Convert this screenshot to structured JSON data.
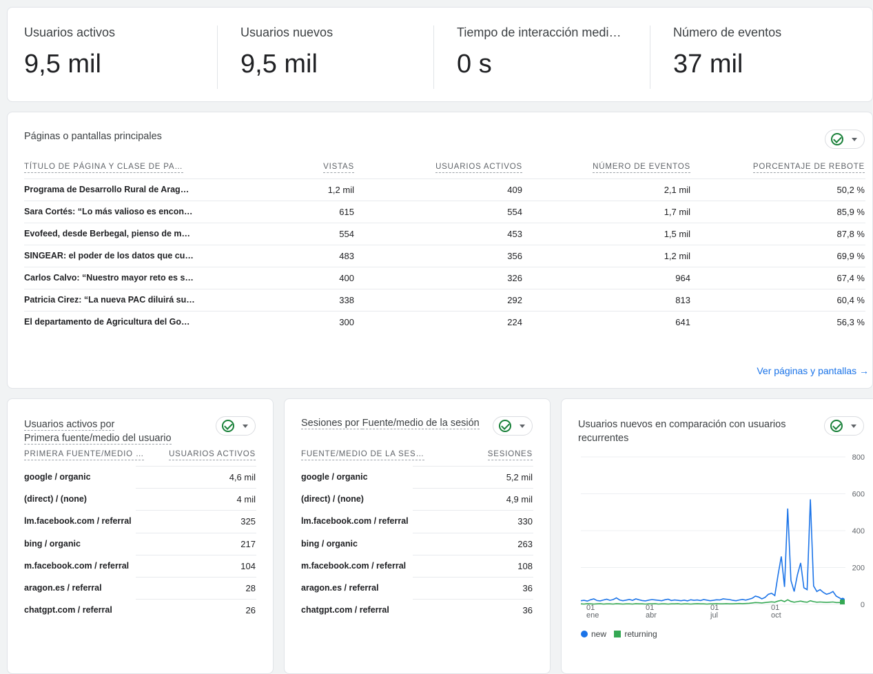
{
  "kpis": [
    {
      "label": "Usuarios activos",
      "value": "9,5 mil"
    },
    {
      "label": "Usuarios nuevos",
      "value": "9,5 mil"
    },
    {
      "label": "Tiempo de interacción medi…",
      "value": "0 s"
    },
    {
      "label": "Número de eventos",
      "value": "37 mil"
    }
  ],
  "pages": {
    "title": "Páginas o pantallas principales",
    "headers": [
      "TÍTULO DE PÁGINA Y CLASE DE PA…",
      "VISTAS",
      "USUARIOS ACTIVOS",
      "NÚMERO DE EVENTOS",
      "PORCENTAJE DE REBOTE"
    ],
    "rows": [
      [
        "Programa de Desarrollo Rural de Arag…",
        "1,2 mil",
        "409",
        "2,1 mil",
        "50,2 %"
      ],
      [
        "Sara Cortés: “Lo más valioso es encon…",
        "615",
        "554",
        "1,7 mil",
        "85,9 %"
      ],
      [
        "Evofeed, desde Berbegal, pienso de m…",
        "554",
        "453",
        "1,5 mil",
        "87,8 %"
      ],
      [
        "SINGEAR: el poder de los datos que cu…",
        "483",
        "356",
        "1,2 mil",
        "69,9 %"
      ],
      [
        "Carlos Calvo: “Nuestro mayor reto es s…",
        "400",
        "326",
        "964",
        "67,4 %"
      ],
      [
        "Patricia Cirez: “La nueva PAC diluirá su…",
        "338",
        "292",
        "813",
        "60,4 %"
      ],
      [
        "El departamento de Agricultura del Go…",
        "300",
        "224",
        "641",
        "56,3 %"
      ]
    ],
    "link": "Ver páginas y pantallas"
  },
  "sources": {
    "title_line1": "Usuarios activos por",
    "title_line2": "Primera fuente/medio del usuario",
    "headers": [
      "PRIMERA FUENTE/MEDIO …",
      "USUARIOS ACTIVOS"
    ],
    "rows": [
      [
        "google / organic",
        "4,6 mil"
      ],
      [
        "(direct) / (none)",
        "4 mil"
      ],
      [
        "lm.facebook.com / referral",
        "325"
      ],
      [
        "bing / organic",
        "217"
      ],
      [
        "m.facebook.com / referral",
        "104"
      ],
      [
        "aragon.es / referral",
        "28"
      ],
      [
        "chatgpt.com / referral",
        "26"
      ]
    ]
  },
  "sessions": {
    "title_prefix": "Sesiones por ",
    "title_dim": "Fuente/medio de la sesión",
    "headers": [
      "FUENTE/MEDIO DE LA SES…",
      "SESIONES"
    ],
    "rows": [
      [
        "google / organic",
        "5,2 mil"
      ],
      [
        "(direct) / (none)",
        "4,9 mil"
      ],
      [
        "lm.facebook.com / referral",
        "330"
      ],
      [
        "bing / organic",
        "263"
      ],
      [
        "m.facebook.com / referral",
        "108"
      ],
      [
        "aragon.es / referral",
        "36"
      ],
      [
        "chatgpt.com / referral",
        "36"
      ]
    ]
  },
  "newret": {
    "title_line1": "Usuarios nuevos en comparación con usuarios",
    "title_line2": "recurrentes",
    "legend_new": "new",
    "legend_ret": "returning"
  },
  "colors": {
    "new": "#1a73e8",
    "returning": "#34a853",
    "accent": "#1a73e8"
  },
  "chart_data": {
    "type": "line",
    "x_ticks": [
      [
        "01",
        "ene"
      ],
      [
        "01",
        "abr"
      ],
      [
        "01",
        "jul"
      ],
      [
        "01",
        "oct"
      ]
    ],
    "y_ticks": [
      "0",
      "200",
      "400",
      "600",
      "800"
    ],
    "ylim": [
      0,
      800
    ],
    "series": [
      {
        "name": "new",
        "values": [
          20,
          22,
          18,
          25,
          30,
          21,
          19,
          24,
          28,
          22,
          26,
          35,
          24,
          20,
          23,
          27,
          22,
          30,
          25,
          21,
          19,
          23,
          26,
          24,
          22,
          20,
          25,
          28,
          21,
          24,
          22,
          20,
          23,
          19,
          25,
          22,
          24,
          21,
          26,
          23,
          20,
          22,
          25,
          24,
          30,
          28,
          26,
          22,
          20,
          24,
          27,
          23,
          28,
          33,
          45,
          40,
          30,
          38,
          55,
          60,
          48,
          160,
          260,
          95,
          520,
          130,
          70,
          160,
          225,
          90,
          80,
          570,
          100,
          70,
          80,
          65,
          55,
          60,
          70,
          45,
          35,
          25
        ]
      },
      {
        "name": "returning",
        "values": [
          3,
          2,
          4,
          3,
          2,
          3,
          4,
          2,
          3,
          3,
          2,
          4,
          3,
          2,
          3,
          3,
          2,
          4,
          3,
          3,
          2,
          3,
          3,
          4,
          2,
          3,
          3,
          2,
          3,
          3,
          4,
          2,
          3,
          3,
          2,
          3,
          4,
          3,
          3,
          2,
          3,
          3,
          4,
          3,
          3,
          4,
          3,
          3,
          4,
          5,
          4,
          5,
          6,
          8,
          10,
          9,
          8,
          10,
          12,
          14,
          12,
          18,
          22,
          15,
          25,
          16,
          12,
          15,
          18,
          14,
          12,
          20,
          15,
          12,
          13,
          12,
          11,
          12,
          13,
          10,
          10,
          15
        ]
      }
    ]
  }
}
